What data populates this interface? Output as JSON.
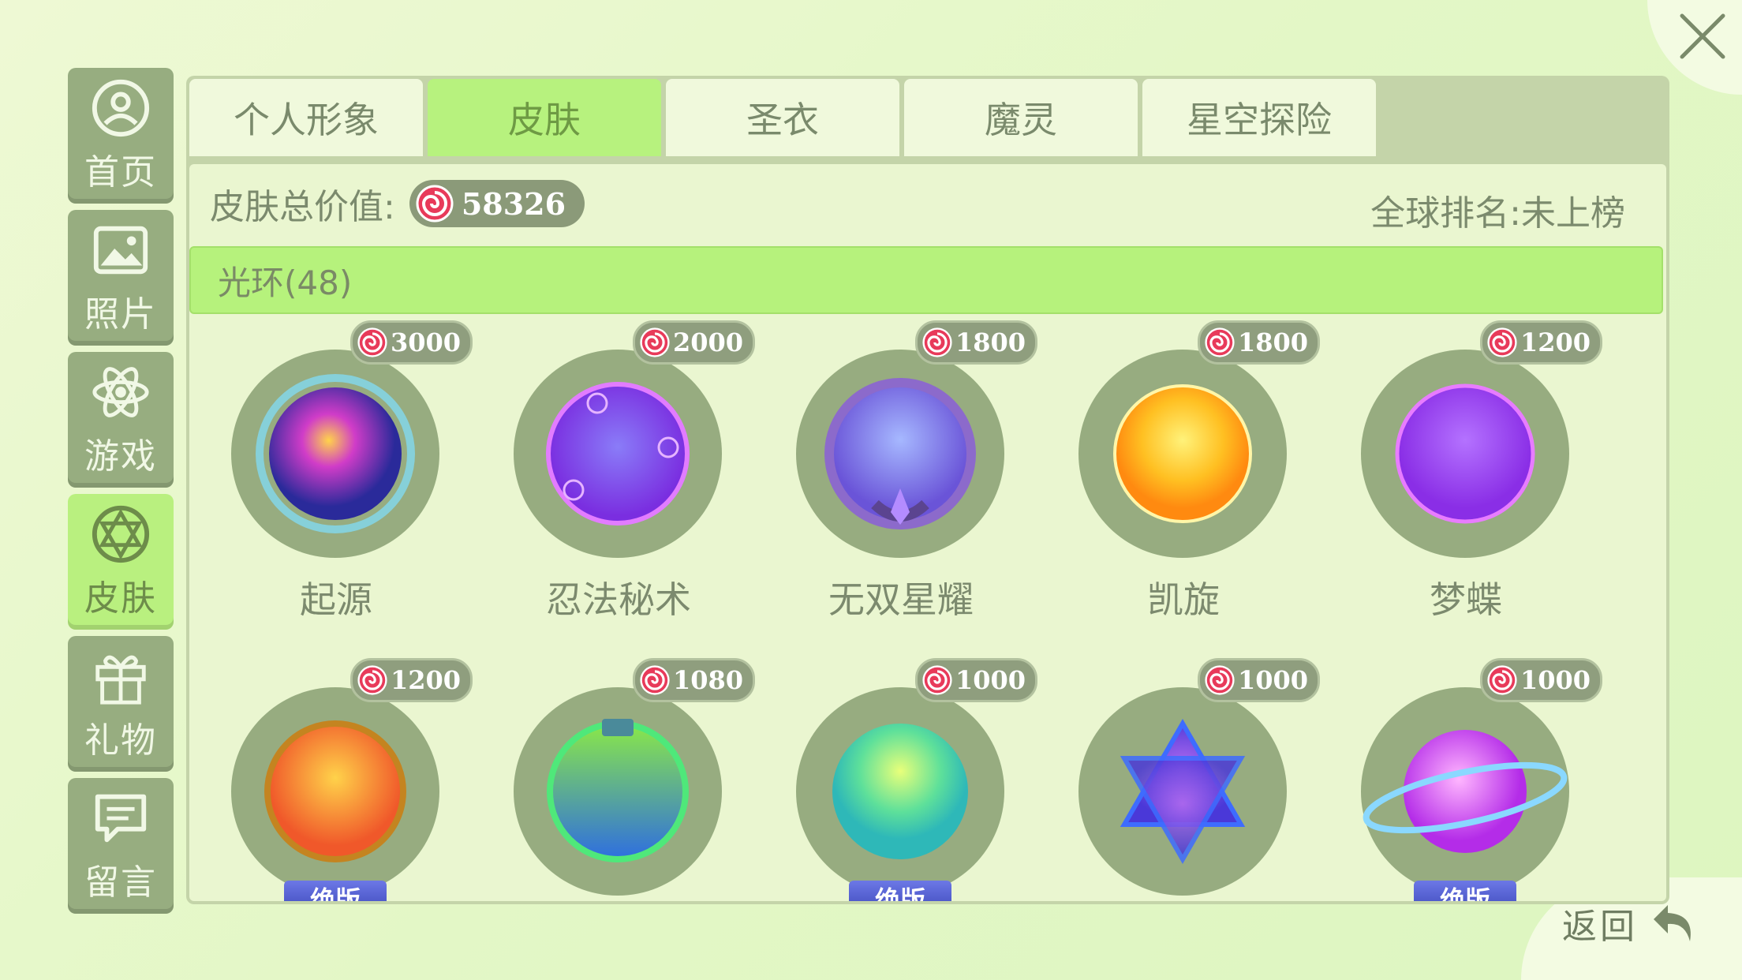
{
  "header": {
    "close_label": "",
    "back_label": "返回"
  },
  "sidebar": {
    "items": [
      {
        "label": "首页",
        "icon": "home-icon"
      },
      {
        "label": "照片",
        "icon": "photo-icon"
      },
      {
        "label": "游戏",
        "icon": "atom-icon"
      },
      {
        "label": "皮肤",
        "icon": "skin-icon",
        "active": true
      },
      {
        "label": "礼物",
        "icon": "gift-icon"
      },
      {
        "label": "留言",
        "icon": "message-icon"
      }
    ]
  },
  "tabs": [
    {
      "label": "个人形象"
    },
    {
      "label": "皮肤",
      "active": true
    },
    {
      "label": "圣衣"
    },
    {
      "label": "魔灵"
    },
    {
      "label": "星空探险"
    }
  ],
  "summary": {
    "label": "皮肤总价值:",
    "value": "58326",
    "ranking": "全球排名:未上榜"
  },
  "category": {
    "label": "光环(48)"
  },
  "items": [
    {
      "name": "起源",
      "price": "3000",
      "color": "#6a2bd8"
    },
    {
      "name": "忍法秘术",
      "price": "2000",
      "color": "#9b5cf0"
    },
    {
      "name": "无双星耀",
      "price": "1800",
      "color": "#7b86e8"
    },
    {
      "name": "凯旋",
      "price": "1800",
      "color": "#ffb81a"
    },
    {
      "name": "梦蝶",
      "price": "1200",
      "color": "#a24cf0"
    },
    {
      "name": "",
      "price": "1200",
      "color": "#f08a2a",
      "badge": "绝版"
    },
    {
      "name": "",
      "price": "1080",
      "color": "#1fb4b8"
    },
    {
      "name": "",
      "price": "1000",
      "color": "#4fd99a",
      "badge": "绝版"
    },
    {
      "name": "",
      "price": "1000",
      "color": "#6f53e6"
    },
    {
      "name": "",
      "price": "1000",
      "color": "#d45af2",
      "badge": "绝版"
    }
  ]
}
